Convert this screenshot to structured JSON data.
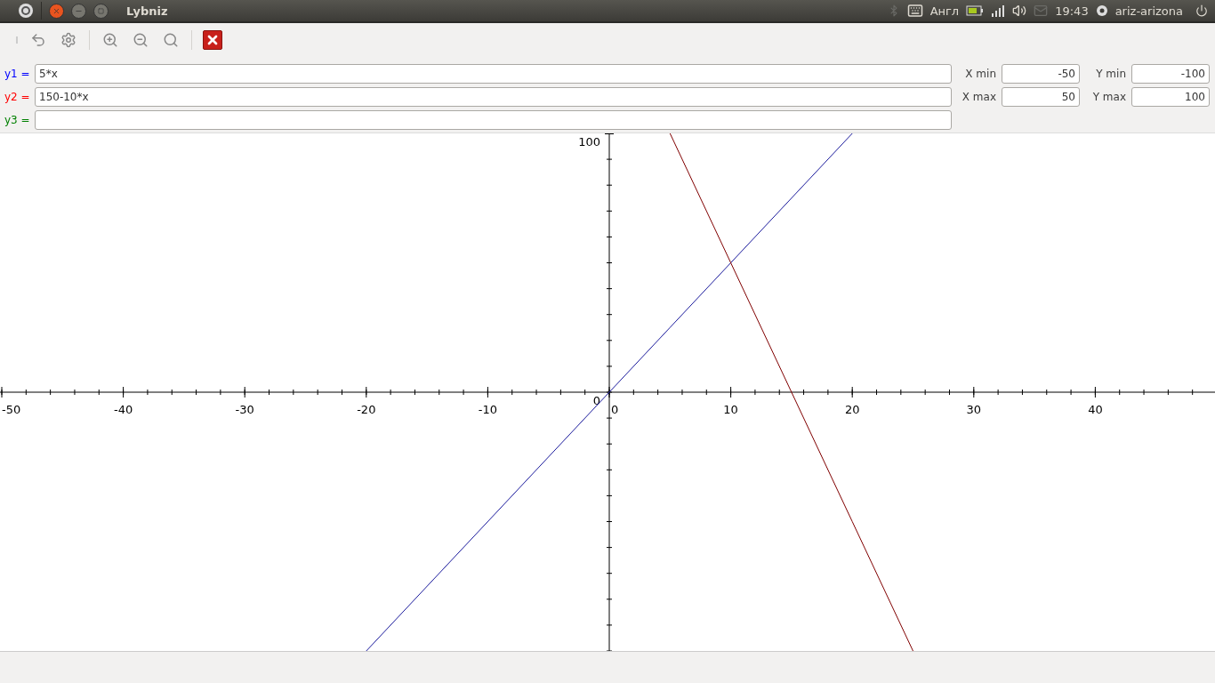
{
  "top_panel": {
    "window_title": "Lybniz",
    "keyboard_layout": "Англ",
    "clock": "19:43",
    "user": "ariz-arizona"
  },
  "functions": [
    {
      "label": "y1 =",
      "value": "5*x",
      "color": "#0000ff"
    },
    {
      "label": "y2 =",
      "value": "150-10*x",
      "color": "#ff0000"
    },
    {
      "label": "y3 =",
      "color": "#008000"
    }
  ],
  "range": [
    {
      "label": "X min",
      "value": "-50"
    },
    {
      "label": "Y min",
      "value": "-100"
    },
    {
      "label": "X max",
      "value": "50"
    },
    {
      "label": "Y max",
      "value": "100"
    }
  ],
  "chart_data": {
    "type": "line",
    "x": [
      -20,
      5,
      20,
      25
    ],
    "xlim": [
      -50,
      50
    ],
    "ylim": [
      -100,
      100
    ],
    "xticks": [
      -50,
      -40,
      -30,
      -20,
      -10,
      0,
      10,
      20,
      30,
      40
    ],
    "yticks": [
      0,
      100
    ],
    "series": [
      {
        "color": "#1a1a9c",
        "values": [
          -100,
          25,
          100,
          null
        ]
      },
      {
        "color": "#800000",
        "values": [
          null,
          100,
          -50,
          -100
        ]
      }
    ]
  }
}
